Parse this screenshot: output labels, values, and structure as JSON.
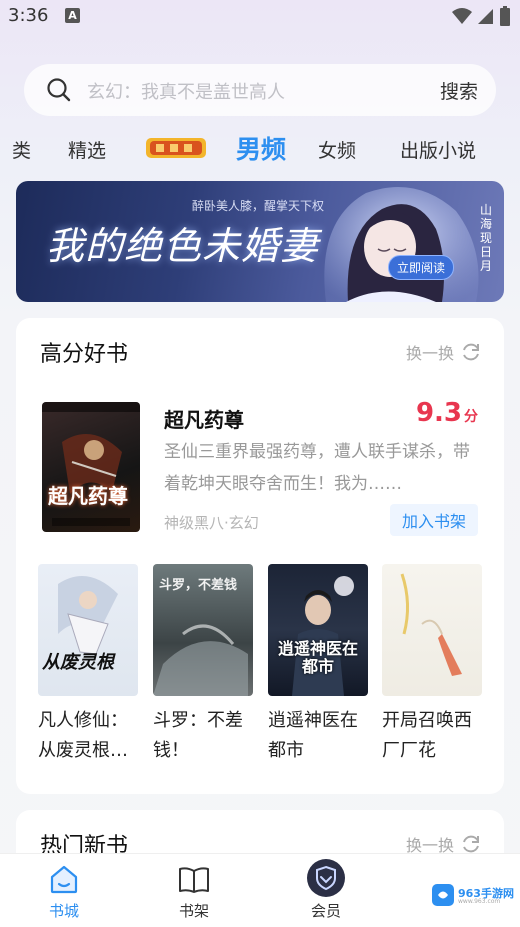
{
  "status_bar": {
    "time": "3:36",
    "indicator": "A",
    "icons": [
      "wifi-icon",
      "signal-icon",
      "battery-icon"
    ]
  },
  "search": {
    "placeholder": "玄幻：我真不是盖世高人",
    "button": "搜索"
  },
  "tabs": [
    {
      "label": "类"
    },
    {
      "label": "精选"
    },
    {
      "label": "男频",
      "active": true
    },
    {
      "label": "女频"
    },
    {
      "label": "出版小说"
    }
  ],
  "banner": {
    "subtitle": "醉卧美人膝，醒掌天下权",
    "title": "我的绝色未婚妻",
    "cta": "立即阅读",
    "side_text": "山海现日月"
  },
  "high_score": {
    "title": "高分好书",
    "refresh_label": "换一换",
    "featured": {
      "title": "超凡药尊",
      "score": "9.3",
      "score_unit": "分",
      "description": "圣仙三重界最强药尊，遭人联手谋杀，带着乾坤天眼夺舍而生！我为……",
      "author": "神级黑八",
      "genre": "玄幻",
      "meta_separator": "·",
      "add_label": "加入书架",
      "cover_text": "超凡药尊"
    },
    "books": [
      {
        "title": "凡人修仙：从废灵根…",
        "cover_text": "从废灵根"
      },
      {
        "title": "斗罗：不差钱！",
        "cover_text": "斗罗，不差钱"
      },
      {
        "title": "逍遥神医在都市",
        "cover_text": "逍遥神医在都市"
      },
      {
        "title": "开局召唤西厂厂花",
        "cover_text": ""
      }
    ]
  },
  "new_books": {
    "title": "热门新书",
    "refresh_label": "换一换"
  },
  "bottom_nav": [
    {
      "label": "书城",
      "icon": "home-icon",
      "active": true
    },
    {
      "label": "书架",
      "icon": "book-icon"
    },
    {
      "label": "会员",
      "icon": "vip-shield-icon"
    }
  ],
  "watermark": {
    "text": "963手游网",
    "sub": "www.963.com"
  },
  "colors": {
    "accent": "#2d8ff0",
    "score": "#e8364f"
  }
}
